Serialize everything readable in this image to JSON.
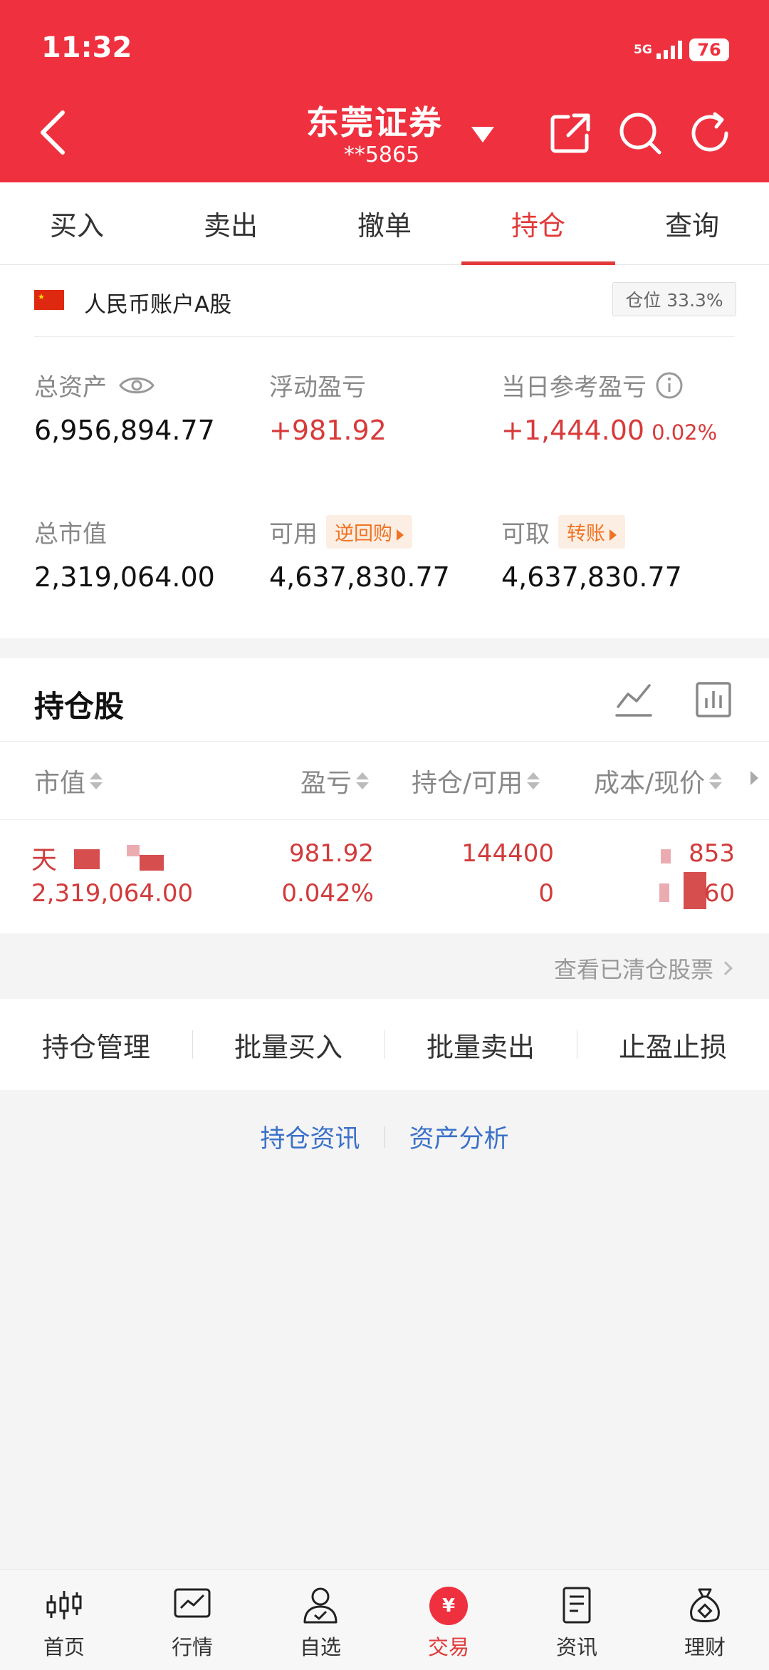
{
  "status_bar": {
    "time": "11:32",
    "network": "5G",
    "battery": "76"
  },
  "header": {
    "broker": "东莞证券",
    "account": "**5865"
  },
  "tabs": [
    "买入",
    "卖出",
    "撤单",
    "持仓",
    "查询"
  ],
  "active_tab": "持仓",
  "account": {
    "name": "人民币账户A股",
    "position_label": "仓位 33.3%",
    "total_assets_label": "总资产",
    "total_assets": "6,956,894.77",
    "floating_pnl_label": "浮动盈亏",
    "floating_pnl": "+981.92",
    "daily_pnl_label": "当日参考盈亏",
    "daily_pnl": "+1,444.00",
    "daily_pnl_pct": "0.02%",
    "market_value_label": "总市值",
    "market_value": "2,319,064.00",
    "available_label": "可用",
    "available_tag": "逆回购",
    "available": "4,637,830.77",
    "withdrawable_label": "可取",
    "withdrawable_tag": "转账",
    "withdrawable": "4,637,830.77"
  },
  "holdings": {
    "title": "持仓股",
    "columns": [
      "市值",
      "盈亏",
      "持仓/可用",
      "成本/现价"
    ],
    "rows": [
      {
        "name_fragment": "天",
        "market_value": "2,319,064.00",
        "pnl": "981.92",
        "pnl_pct": "0.042%",
        "holding": "144400",
        "available": "0",
        "cost_fragment": "853",
        "price_fragment": "60"
      }
    ]
  },
  "cleared_link": "查看已清仓股票",
  "actions": [
    "持仓管理",
    "批量买入",
    "批量卖出",
    "止盈止损"
  ],
  "info_links": [
    "持仓资讯",
    "资产分析"
  ],
  "bottom_nav": [
    {
      "label": "首页",
      "icon": "candlestick-icon"
    },
    {
      "label": "行情",
      "icon": "chart-line-icon"
    },
    {
      "label": "自选",
      "icon": "user-check-icon"
    },
    {
      "label": "交易",
      "icon": "yen-icon"
    },
    {
      "label": "资讯",
      "icon": "document-icon"
    },
    {
      "label": "理财",
      "icon": "money-bag-icon"
    }
  ],
  "colors": {
    "brand_red": "#ef313f",
    "profit_red": "#d83a3a",
    "link_blue": "#3a71c9",
    "tag_orange": "#ef7323"
  }
}
